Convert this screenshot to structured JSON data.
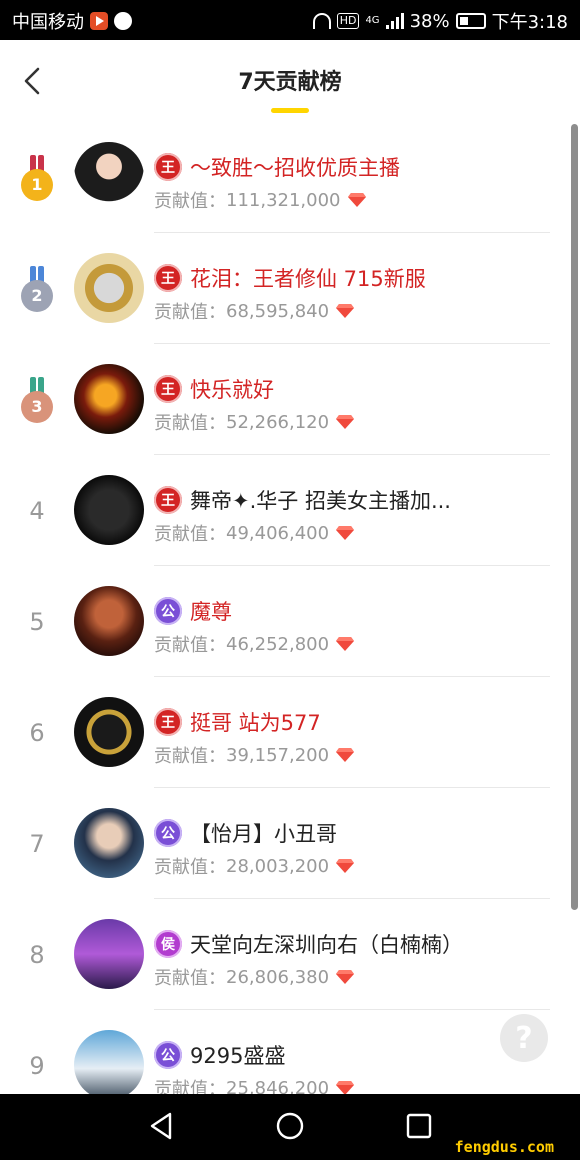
{
  "status_bar": {
    "carrier": "中国移动",
    "hd_label": "HD",
    "network": "4G",
    "battery": "38%",
    "time": "下午3:18"
  },
  "header": {
    "title": "7天贡献榜",
    "back_icon": "chevron-left-icon",
    "accent_color": "#ffd500"
  },
  "contribution_label": "贡献值：",
  "list": [
    {
      "rank": "1",
      "medal": "gold",
      "badge": "王",
      "badge_type": "king",
      "name": "～致胜～招收优质主播",
      "name_color": "red",
      "value": "111,321,000"
    },
    {
      "rank": "2",
      "medal": "silver",
      "badge": "王",
      "badge_type": "king",
      "name": "花泪：王者修仙 715新服",
      "name_color": "red",
      "value": "68,595,840"
    },
    {
      "rank": "3",
      "medal": "bronze",
      "badge": "王",
      "badge_type": "king",
      "name": "快乐就好",
      "name_color": "red",
      "value": "52,266,120"
    },
    {
      "rank": "4",
      "badge": "王",
      "badge_type": "king",
      "name": "舞帝✦.华子 招美女主播加...",
      "name_color": "black",
      "value": "49,406,400"
    },
    {
      "rank": "5",
      "badge": "公",
      "badge_type": "duke",
      "name": "魔尊",
      "name_color": "red",
      "value": "46,252,800"
    },
    {
      "rank": "6",
      "badge": "王",
      "badge_type": "king",
      "name": "挺哥 站为577",
      "name_color": "red",
      "value": "39,157,200"
    },
    {
      "rank": "7",
      "badge": "公",
      "badge_type": "duke",
      "name": "【怡月】小丑哥",
      "name_color": "black",
      "value": "28,003,200"
    },
    {
      "rank": "8",
      "badge": "侯",
      "badge_type": "marquis",
      "name": "天堂向左深圳向右（白楠楠）",
      "name_color": "black",
      "value": "26,806,380"
    },
    {
      "rank": "9",
      "badge": "公",
      "badge_type": "duke",
      "name": "9295盛盛",
      "name_color": "black",
      "value": "25,846,200"
    }
  ],
  "help": {
    "label": "?"
  },
  "watermark": "fengdus.com",
  "colors": {
    "king": "#d32424",
    "duke": "#7a4fd6",
    "marquis": "#b23ccf",
    "gem": "#f0493c"
  }
}
